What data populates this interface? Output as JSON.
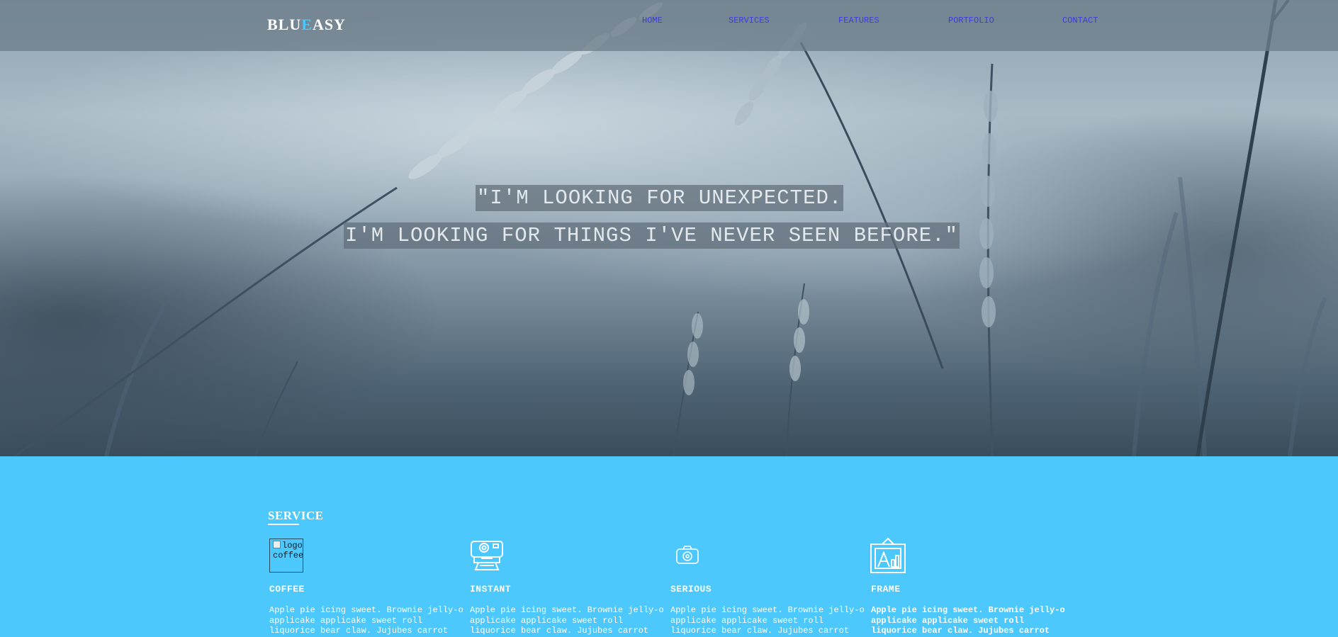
{
  "brand": {
    "logo_part1": "BLU",
    "logo_accent": "E",
    "logo_part2": "ASY",
    "accent_color": "#4cc8fc"
  },
  "nav": {
    "items": [
      {
        "label": "HOME"
      },
      {
        "label": "SERVICES"
      },
      {
        "label": "FEATURES"
      },
      {
        "label": "PORTFOLIO"
      },
      {
        "label": "CONTACT"
      }
    ],
    "link_color": "#3b3bdc"
  },
  "hero": {
    "quote_line1": "\"I'M LOOKING FOR UNEXPECTED.",
    "quote_line2": "I'M LOOKING FOR THINGS I'VE NEVER SEEN BEFORE.\""
  },
  "service": {
    "title": "SERVICE",
    "background_color": "#4cc8fc",
    "cards": [
      {
        "icon": "broken-image-icon",
        "image_alt": "logo coffee",
        "title": "COFFEE",
        "text": "Apple pie icing sweet. Brownie jelly-o applicake applicake sweet roll liquorice bear claw. Jujubes carrot"
      },
      {
        "icon": "polaroid-camera-icon",
        "title": "INSTANT",
        "text": "Apple pie icing sweet. Brownie jelly-o applicake applicake sweet roll liquorice bear claw. Jujubes carrot"
      },
      {
        "icon": "camera-icon",
        "title": "SERIOUS",
        "text": "Apple pie icing sweet. Brownie jelly-o applicake applicake sweet roll liquorice bear claw. Jujubes carrot"
      },
      {
        "icon": "picture-frame-icon",
        "title": "FRAME",
        "text": "Apple pie icing sweet. Brownie jelly-o applicake applicake sweet roll liquorice bear claw. Jujubes carrot"
      }
    ]
  }
}
